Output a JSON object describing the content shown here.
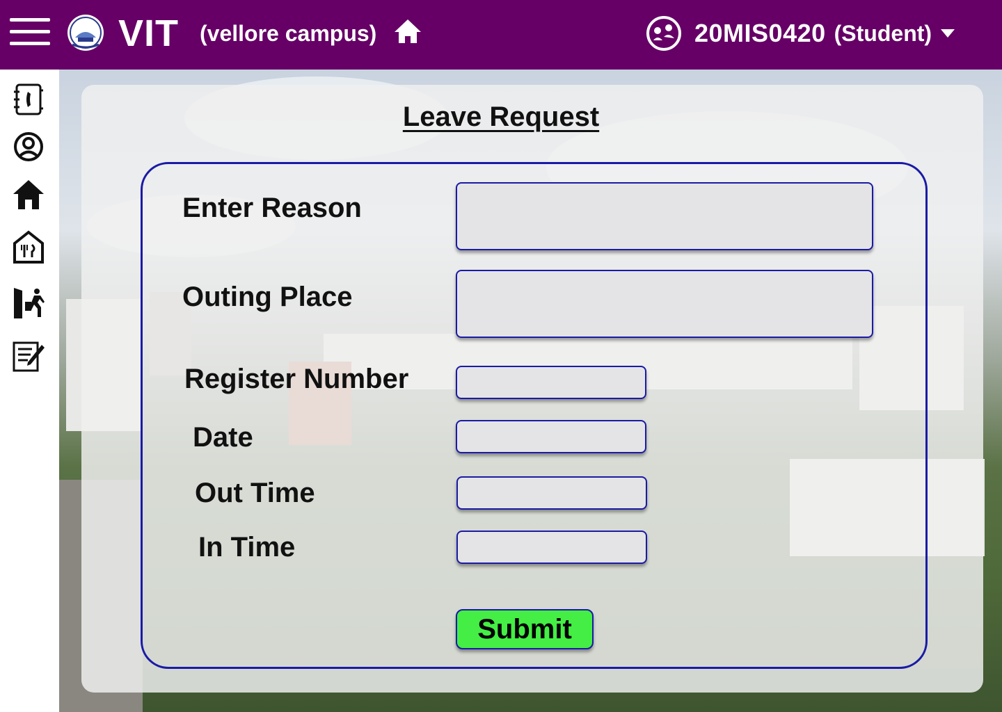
{
  "header": {
    "brand": "VIT",
    "campus": "(vellore campus)",
    "user_id": "20MIS0420",
    "user_role": "(Student)",
    "bg_color": "#660066"
  },
  "sidebar": {
    "items": [
      {
        "icon": "contacts-book-icon"
      },
      {
        "icon": "profile-icon"
      },
      {
        "icon": "home-icon"
      },
      {
        "icon": "mess-icon"
      },
      {
        "icon": "outing-icon"
      },
      {
        "icon": "notes-icon"
      }
    ]
  },
  "form": {
    "title": "Leave Request",
    "fields": [
      {
        "label": "Enter Reason",
        "value": ""
      },
      {
        "label": "Outing Place",
        "value": ""
      },
      {
        "label": "Register Number",
        "value": ""
      },
      {
        "label": "Date",
        "value": ""
      },
      {
        "label": "Out Time",
        "value": ""
      },
      {
        "label": "In Time",
        "value": ""
      }
    ],
    "submit_label": "Submit",
    "submit_color": "#44ee44",
    "border_color": "#1a1aa6"
  }
}
